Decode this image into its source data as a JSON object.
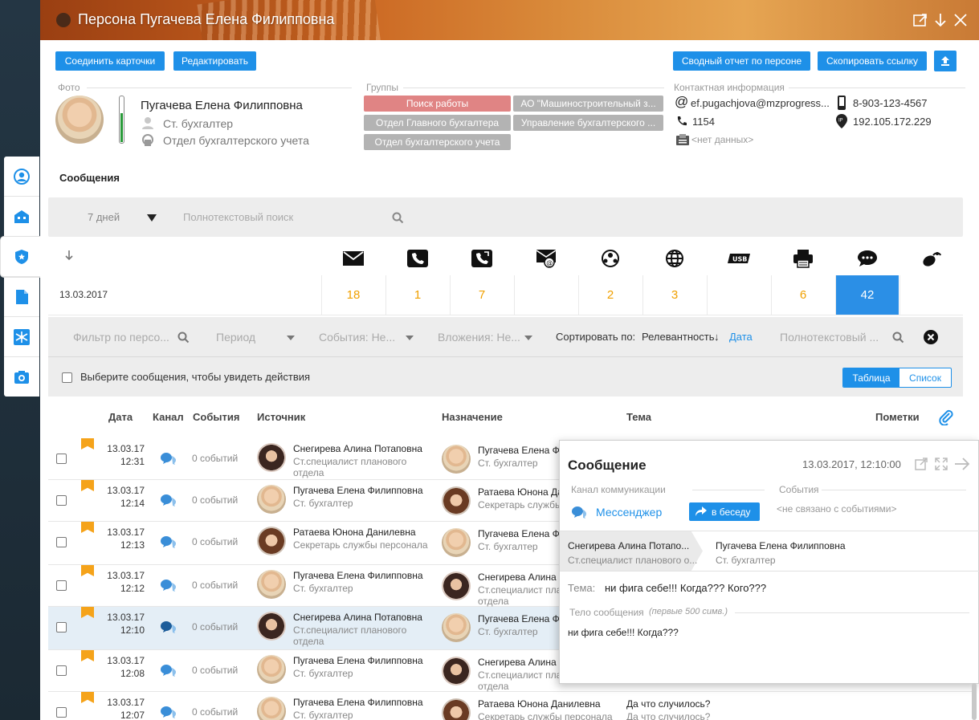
{
  "window": {
    "title": "Персона Пугачева Елена Филипповна"
  },
  "toolbar": {
    "merge_label": "Соединить карточки",
    "edit_label": "Редактировать",
    "report_label": "Сводный отчет по персоне",
    "copy_link_label": "Скопировать ссылку"
  },
  "profile": {
    "photo_label": "Фото",
    "name": "Пугачева Елена Филипповна",
    "position": "Ст. бухгалтер",
    "department": "Отдел бухгалтерского учета"
  },
  "groups": {
    "label": "Группы",
    "tags": [
      {
        "label": "Поиск работы",
        "color": "#e08484"
      },
      {
        "label": "АО \"Машиностроительный з...",
        "color": "#b3b3b3"
      },
      {
        "label": "Отдел Главного бухгалтера",
        "color": "#b3b3b3"
      },
      {
        "label": "Управление бухгалтерского ...",
        "color": "#b3b3b3"
      },
      {
        "label": "Отдел бухгалтерского учета",
        "color": "#b3b3b3"
      }
    ]
  },
  "contacts": {
    "label": "Контактная информация",
    "email": "ef.pugachjova@mzprogress...",
    "mobile": "8-903-123-4567",
    "ext": "1154",
    "ip": "192.105.172.229",
    "fax": "<нет данных>"
  },
  "messages": {
    "section_title": "Сообщения",
    "period": "7 дней",
    "search_placeholder": "Полнотекстовый поиск",
    "date": "13.03.2017",
    "counts": [
      "18",
      "1",
      "7",
      "",
      "2",
      "3",
      "",
      "6",
      "42",
      ""
    ]
  },
  "filters": {
    "person_placeholder": "Фильтр по персо...",
    "period_placeholder": "Период",
    "events_placeholder": "События: Не...",
    "attachments_placeholder": "Вложения: Не...",
    "sort_label": "Сортировать по:",
    "sort_relevance": "Релевантность",
    "sort_arrow": "↓",
    "sort_date": "Дата",
    "fulltext_placeholder": "Полнотекстовый ...",
    "select_hint": "Выберите сообщения, чтобы увидеть действия",
    "view_table": "Таблица",
    "view_list": "Список"
  },
  "table": {
    "columns": {
      "date": "Дата",
      "channel": "Канал",
      "events": "События",
      "source": "Источник",
      "dest": "Назначение",
      "subject": "Тема",
      "marks": "Пометки"
    },
    "rows": [
      {
        "date": "13.03.17",
        "time": "12:31",
        "events": "0 событий",
        "src_name": "Снегирева Алина Потаповна",
        "src_sub1": "Ст.специалист планового",
        "src_sub2": "отдела",
        "dst_name": "Пугачева Елена Ф",
        "dst_sub1": "Ст. бухгалтер",
        "dst_sub2": ""
      },
      {
        "date": "13.03.17",
        "time": "12:14",
        "events": "0 событий",
        "src_name": "Пугачева Елена Филипповна",
        "src_sub1": "Ст. бухгалтер",
        "src_sub2": "",
        "dst_name": "Ратаева Юнона Да",
        "dst_sub1": "Секретарь службы",
        "dst_sub2": ""
      },
      {
        "date": "13.03.17",
        "time": "12:13",
        "events": "0 событий",
        "src_name": "Ратаева Юнона Данилевна",
        "src_sub1": "Секретарь службы персонала",
        "src_sub2": "",
        "dst_name": "Пугачева Елена Ф",
        "dst_sub1": "Ст. бухгалтер",
        "dst_sub2": ""
      },
      {
        "date": "13.03.17",
        "time": "12:12",
        "events": "0 событий",
        "src_name": "Пугачева Елена Филипповна",
        "src_sub1": "Ст. бухгалтер",
        "src_sub2": "",
        "dst_name": "Снегирева Алина П",
        "dst_sub1": "Ст.специалист пла",
        "dst_sub2": "отдела"
      },
      {
        "date": "13.03.17",
        "time": "12:10",
        "events": "0 событий",
        "src_name": "Снегирева Алина Потаповна",
        "src_sub1": "Ст.специалист планового",
        "src_sub2": "отдела",
        "dst_name": "Пугачева Елена Ф",
        "dst_sub1": "Ст. бухгалтер",
        "dst_sub2": ""
      },
      {
        "date": "13.03.17",
        "time": "12:08",
        "events": "0 событий",
        "src_name": "Пугачева Елена Филипповна",
        "src_sub1": "Ст. бухгалтер",
        "src_sub2": "",
        "dst_name": "Снегирева Алина Потаповна",
        "dst_sub1": "Ст.специалист планового",
        "dst_sub2": "отдела"
      },
      {
        "date": "13.03.17",
        "time": "12:07",
        "events": "0 событий",
        "src_name": "Пугачева Елена Филипповна",
        "src_sub1": "Ст. бухгалтер",
        "src_sub2": "",
        "dst_name": "Ратаева Юнона Данилевна",
        "dst_sub1": "Секретарь службы персонала",
        "dst_sub2": "",
        "subject": "Да что случилось?",
        "subject_sub": "Да что случилось?"
      }
    ]
  },
  "popup": {
    "title": "Сообщение",
    "datetime": "13.03.2017, 12:10:00",
    "channel_label": "Канал коммуникации",
    "channel_value": "Мессенджер",
    "chat_button": "в беседу",
    "events_label": "События",
    "events_value": "<не связано с событиями>",
    "from_name": "Снегирева Алина Потапо...",
    "from_sub": "Ст.специалист планового о...",
    "to_name": "Пугачева Елена Филипповна",
    "to_sub": "Ст. бухгалтер",
    "subject_label": "Тема:",
    "subject_value": "ни фига себе!!! Когда??? Кого???",
    "body_label": "Тело сообщения",
    "body_note": "(первые 500 симв.)",
    "body_value": "ни фига себе!!! Когда???"
  },
  "colors": {
    "accent": "#1e90e8",
    "count": "#f0a000",
    "flag": "#f5a31a",
    "tag_red": "#e08484"
  }
}
